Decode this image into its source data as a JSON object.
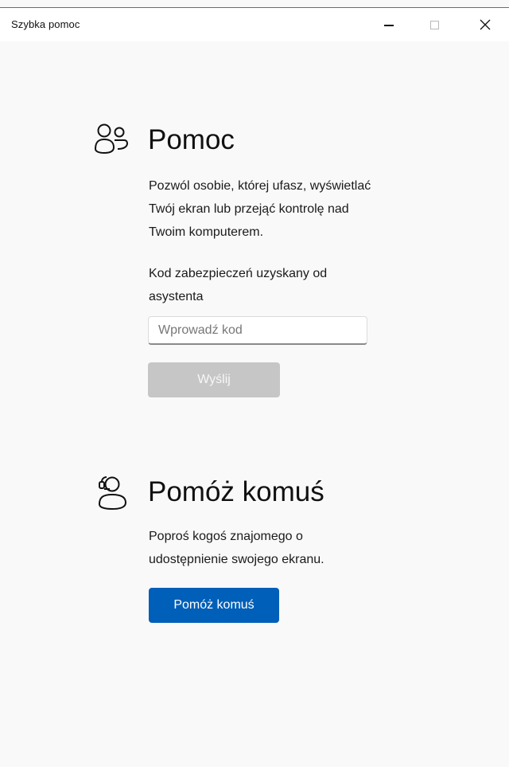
{
  "window": {
    "title": "Szybka pomoc"
  },
  "get_help": {
    "icon": "people-icon",
    "heading": "Pomoc",
    "description_lines": [
      "Pozwól osobie, której ufasz, wyświetlać",
      "Twój ekran lub przejąć kontrolę nad",
      "Twoim komputerem."
    ],
    "code_label_lines": [
      "Kod zabezpieczeń uzyskany od",
      "asystenta"
    ],
    "code_input": {
      "placeholder": "Wprowadź kod",
      "value": ""
    },
    "submit_label": "Wyślij"
  },
  "give_help": {
    "icon": "person-support-icon",
    "heading": "Pomóż komuś",
    "description_lines": [
      "Poproś kogoś znajomego o",
      "udostępnienie swojego ekranu."
    ],
    "button_label": "Pomóż komuś"
  },
  "colors": {
    "background": "#f9f9f9",
    "accent": "#005fb8",
    "disabled_button": "#c6c6c6"
  }
}
